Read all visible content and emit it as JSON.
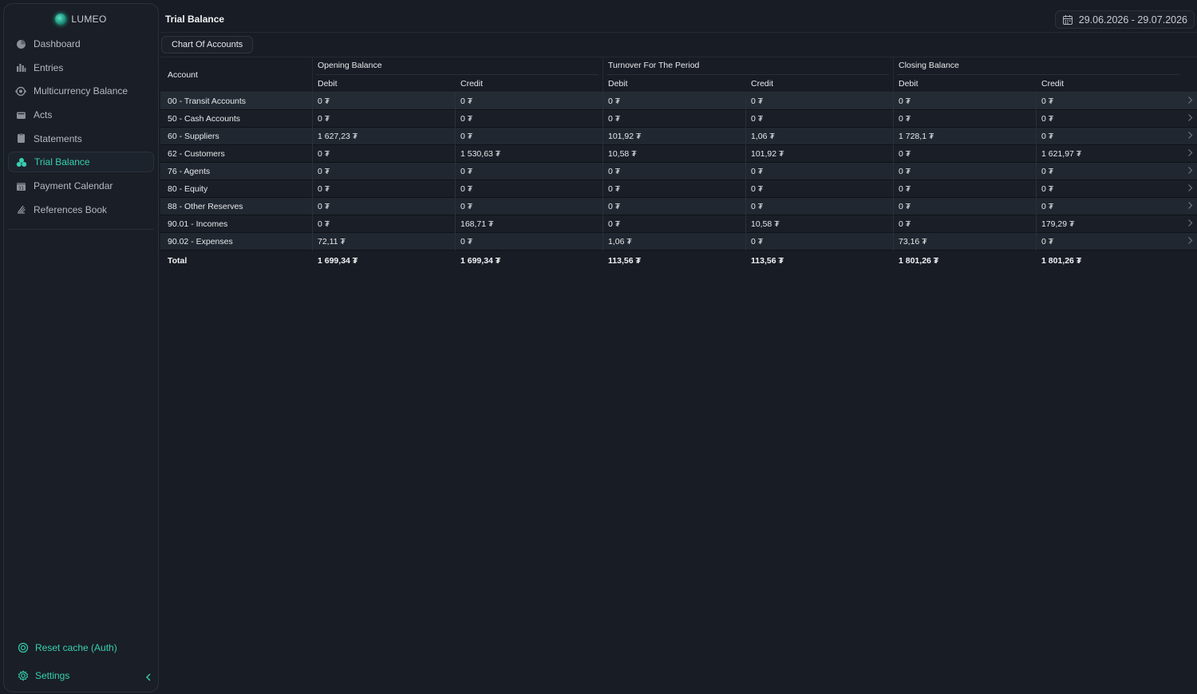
{
  "app": {
    "name": "LUMEO"
  },
  "sidebar": {
    "items": [
      {
        "label": "Dashboard",
        "icon": "dashboard-icon"
      },
      {
        "label": "Entries",
        "icon": "entries-icon"
      },
      {
        "label": "Multicurrency Balance",
        "icon": "multicurrency-icon"
      },
      {
        "label": "Acts",
        "icon": "acts-icon"
      },
      {
        "label": "Statements",
        "icon": "statements-icon"
      },
      {
        "label": "Trial Balance",
        "icon": "trial-balance-icon",
        "active": true
      },
      {
        "label": "Payment Calendar",
        "icon": "calendar-icon"
      },
      {
        "label": "References Book",
        "icon": "references-book-icon"
      }
    ],
    "reset_cache": "Reset cache (Auth)",
    "settings": "Settings"
  },
  "header": {
    "title": "Trial Balance",
    "date_range": "29.06.2026 - 29.07.2026"
  },
  "toolbar": {
    "chart_of_accounts": "Chart Of Accounts"
  },
  "table": {
    "account_header": "Account",
    "groups": [
      "Opening Balance",
      "Turnover For The Period",
      "Closing Balance"
    ],
    "debit": "Debit",
    "credit": "Credit",
    "rows": [
      {
        "account": "00 - Transit Accounts",
        "values": [
          "0 ₮",
          "0 ₮",
          "0 ₮",
          "0 ₮",
          "0 ₮",
          "0 ₮"
        ]
      },
      {
        "account": "50 - Cash Accounts",
        "values": [
          "0 ₮",
          "0 ₮",
          "0 ₮",
          "0 ₮",
          "0 ₮",
          "0 ₮"
        ]
      },
      {
        "account": "60 - Suppliers",
        "values": [
          "1 627,23 ₮",
          "0 ₮",
          "101,92 ₮",
          "1,06 ₮",
          "1 728,1 ₮",
          "0 ₮"
        ]
      },
      {
        "account": "62 - Customers",
        "values": [
          "0 ₮",
          "1 530,63 ₮",
          "10,58 ₮",
          "101,92 ₮",
          "0 ₮",
          "1 621,97 ₮"
        ]
      },
      {
        "account": "76 - Agents",
        "values": [
          "0 ₮",
          "0 ₮",
          "0 ₮",
          "0 ₮",
          "0 ₮",
          "0 ₮"
        ]
      },
      {
        "account": "80 - Equity",
        "values": [
          "0 ₮",
          "0 ₮",
          "0 ₮",
          "0 ₮",
          "0 ₮",
          "0 ₮"
        ]
      },
      {
        "account": "88 - Other Reserves",
        "values": [
          "0 ₮",
          "0 ₮",
          "0 ₮",
          "0 ₮",
          "0 ₮",
          "0 ₮"
        ]
      },
      {
        "account": "90.01 - Incomes",
        "values": [
          "0 ₮",
          "168,71 ₮",
          "0 ₮",
          "10,58 ₮",
          "0 ₮",
          "179,29 ₮"
        ]
      },
      {
        "account": "90.02 - Expenses",
        "values": [
          "72,11 ₮",
          "0 ₮",
          "1,06 ₮",
          "0 ₮",
          "73,16 ₮",
          "0 ₮"
        ]
      }
    ],
    "total": {
      "label": "Total",
      "values": [
        "1 699,34 ₮",
        "1 699,34 ₮",
        "113,56 ₮",
        "113,56 ₮",
        "1 801,26 ₮",
        "1 801,26 ₮"
      ]
    }
  },
  "colors": {
    "accent": "#36d0b0",
    "background": "#181c24",
    "sidebar": "#1a1e26"
  }
}
